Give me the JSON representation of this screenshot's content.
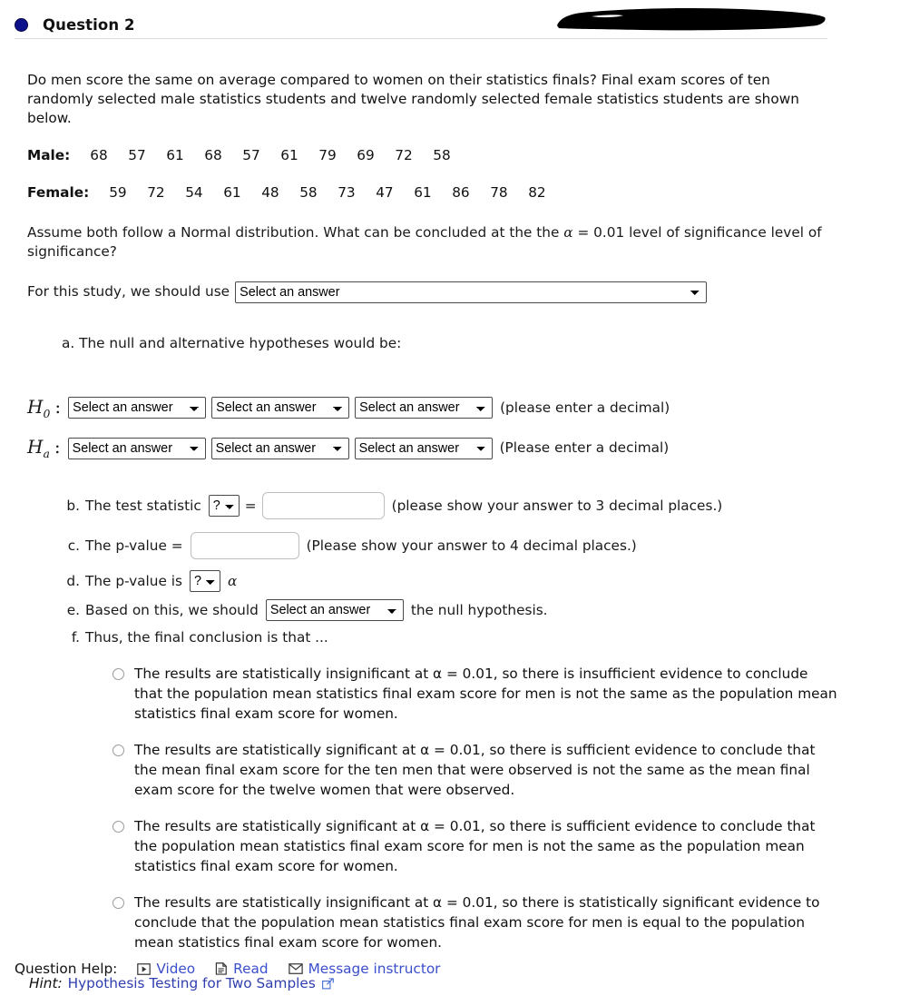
{
  "header": {
    "title": "Question 2",
    "bullet_color": "#0d128c",
    "redaction_present": true
  },
  "prompt": {
    "paragraph": "Do men score the same on average compared to women on their statistics finals? Final exam scores of ten randomly selected male statistics students and twelve randomly selected female statistics students are shown below.",
    "male_label": "Male:",
    "male_values": [
      "68",
      "57",
      "61",
      "68",
      "57",
      "61",
      "79",
      "69",
      "72",
      "58"
    ],
    "female_label": "Female:",
    "female_values": [
      "59",
      "72",
      "54",
      "61",
      "48",
      "58",
      "73",
      "47",
      "61",
      "86",
      "78",
      "82"
    ],
    "assume_pre": "Assume both follow a Normal distribution.  What can be concluded at the the ",
    "assume_alpha": "α",
    "assume_post": " = 0.01 level of significance level of significance?"
  },
  "study": {
    "label": "For this study, we should use",
    "select_value": "Select an answer"
  },
  "item_a": {
    "text": "a. The null and alternative hypotheses would be:"
  },
  "hypotheses": {
    "null": {
      "symbol": "H",
      "subscript": "0",
      "colon": ":",
      "selects": [
        "Select an answer",
        "Select an answer",
        "Select an answer"
      ],
      "note": "(please enter a decimal)"
    },
    "alt": {
      "symbol": "H",
      "subscript": "a",
      "colon": ":",
      "selects": [
        "Select an answer",
        "Select an answer",
        "Select an answer"
      ],
      "note": "(Please enter a decimal)"
    }
  },
  "steps": {
    "b": {
      "marker": "b.",
      "text": "The test statistic",
      "compare_select": "?",
      "equals": "=",
      "input_value": "",
      "input_placeholder": "",
      "note": "(please show your answer to 3 decimal places.)"
    },
    "c": {
      "marker": "c.",
      "text": "The p-value =",
      "input_value": "",
      "input_placeholder": "",
      "note": "(Please show your answer to 4 decimal places.)"
    },
    "d": {
      "marker": "d.",
      "text": "The p-value is",
      "compare_select": "?",
      "alpha": "α"
    },
    "e": {
      "marker": "e.",
      "text_before": "Based on this, we should",
      "select_value": "Select an answer",
      "text_after": "the null hypothesis."
    },
    "f": {
      "marker": "f.",
      "text": "Thus, the final conclusion is that ..."
    }
  },
  "conclusion_options": [
    {
      "id": "option-1",
      "selected": false,
      "text": "The results are statistically insignificant at α = 0.01, so there is insufficient evidence to conclude that the population mean statistics final exam score for men is not the same as the population mean statistics final exam score for women."
    },
    {
      "id": "option-2",
      "selected": false,
      "text": "The results are statistically significant at α = 0.01, so there is sufficient evidence to conclude that the mean final exam score for the ten men that were observed is not the same as the mean final exam score for the twelve women that were observed."
    },
    {
      "id": "option-3",
      "selected": false,
      "text": "The results are statistically significant at α = 0.01, so there is sufficient evidence to conclude that the population mean statistics final exam score for men is not the same as the population mean statistics final exam score for women."
    },
    {
      "id": "option-4",
      "selected": false,
      "text": "The results are statistically insignificant at α = 0.01, so there is statistically significant evidence to conclude that the population mean statistics final exam score for men is equal to the population mean statistics final exam score for women."
    }
  ],
  "hint": {
    "label": "Hint:",
    "link_text": "Hypothesis Testing for Two Samples",
    "link_color": "#2f3fae"
  },
  "question_help": {
    "label": "Question Help:",
    "items": [
      {
        "icon": "video-icon",
        "label": "Video"
      },
      {
        "icon": "read-icon",
        "label": "Read"
      },
      {
        "icon": "envelope-icon",
        "label": "Message instructor"
      }
    ],
    "link_color": "#3b4ecc"
  }
}
